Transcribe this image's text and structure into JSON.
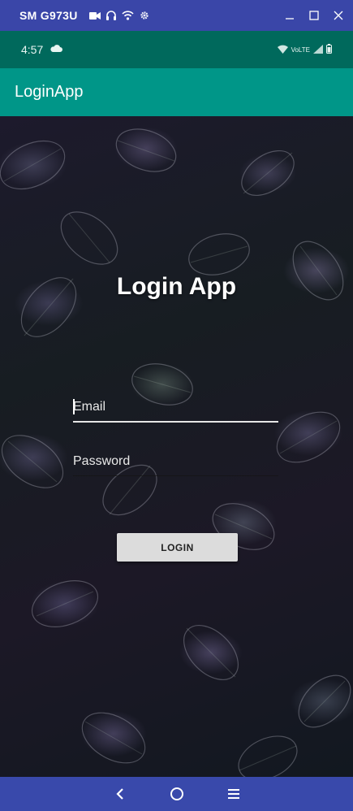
{
  "window": {
    "title": "SM G973U"
  },
  "status_bar": {
    "time": "4:57",
    "network_label": "VoLTE"
  },
  "app_bar": {
    "title": "LoginApp"
  },
  "login": {
    "heading": "Login App",
    "email_placeholder": "Email",
    "password_placeholder": "Password",
    "login_label": "LOGIN"
  },
  "icons": {
    "window": [
      "video-camera-icon",
      "headphones-icon",
      "wifi-icon",
      "gear-icon"
    ],
    "window_controls": [
      "minimize-icon",
      "maximize-icon",
      "close-icon"
    ],
    "status": [
      "cloud-icon",
      "wifi-icon",
      "signal-icon",
      "battery-icon"
    ],
    "nav": [
      "back-icon",
      "home-icon",
      "recents-icon"
    ]
  },
  "colors": {
    "chrome": "#3a46a8",
    "status_bar": "#00695c",
    "app_bar": "#009688",
    "nav_bar": "#3949ab",
    "button": "#dcdcdc"
  }
}
